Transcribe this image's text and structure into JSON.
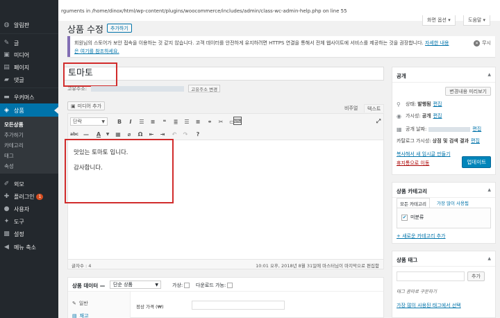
{
  "sidebar": {
    "items": [
      {
        "label": "알림판",
        "icon": "dashboard-icon",
        "glyph": "◍"
      },
      {
        "label": "글",
        "icon": "pin-icon",
        "glyph": "✎"
      },
      {
        "label": "미디어",
        "icon": "media-icon",
        "glyph": "▣"
      },
      {
        "label": "페이지",
        "icon": "page-icon",
        "glyph": "▤"
      },
      {
        "label": "댓글",
        "icon": "comment-icon",
        "glyph": "▰"
      },
      {
        "label": "우커머스",
        "icon": "woocommerce-icon",
        "glyph": "▬"
      },
      {
        "label": "상품",
        "icon": "product-icon",
        "glyph": "◈"
      },
      {
        "label": "외모",
        "icon": "appearance-icon",
        "glyph": "✐"
      },
      {
        "label": "플러그인",
        "icon": "plugin-icon",
        "glyph": "✚",
        "badge": "1"
      },
      {
        "label": "사용자",
        "icon": "user-icon",
        "glyph": "●"
      },
      {
        "label": "도구",
        "icon": "tool-icon",
        "glyph": "✦"
      },
      {
        "label": "설정",
        "icon": "settings-icon",
        "glyph": "▩"
      },
      {
        "label": "메뉴 축소",
        "icon": "collapse-icon",
        "glyph": "◀"
      }
    ],
    "submenu": [
      "모든상품",
      "추가하기",
      "카테고리",
      "태그",
      "속성"
    ]
  },
  "top": {
    "error_text": "rguments in /home/dinox/html/wp-content/plugins/woocommerce/includes/admin/class-wc-admin-help.php on line 55",
    "screen_options": "화면 옵션 ▾",
    "help": "도움말 ▾"
  },
  "header": {
    "title": "상품 수정",
    "add_new": "추가하기"
  },
  "notice": {
    "text": "회원님의 스토어가 보안 접속을 이용하는 것 같지 않습니다. 고객 데이터를 안전하게 유지하려면 HTTPS 연결을 통해서 전체 웹사이트에 서비스를 제공하는 것을 권장합니다.",
    "link": "자세한 내용은 여기를 참조하세요.",
    "dismiss": "무시"
  },
  "post": {
    "title": "토마토",
    "permalink_label": "고유주소:",
    "permalink_button": "고유주소 변경"
  },
  "editor": {
    "add_media": "미디어 추가",
    "tab_visual": "비주얼",
    "tab_text": "텍스트",
    "format": "단락",
    "content": [
      "맛있는 토마토 입니다.",
      "감사합니다."
    ],
    "word_count": "글자수 : 4",
    "last_edited": "10:01 오후, 2018년 8월 31일에 마스터님이 마지막으로 편집함"
  },
  "product_data": {
    "title": "상품 데이터 —",
    "type": "단순 상품",
    "virtual": "가상:",
    "downloadable": "다운로드 가능:",
    "tab_general": "일반",
    "tab_inventory": "재고",
    "regular_price_label": "정상 가격 (₩)"
  },
  "publish": {
    "title": "공개",
    "preview": "변경내용 미리보기",
    "status_label": "상태:",
    "status_value": "발행됨",
    "visibility_label": "가시성:",
    "visibility_value": "공개",
    "published_label": "공개 날짜:",
    "catalog_label": "카탈로그 가시성:",
    "catalog_value": "상점 및 검색 결과",
    "edit": "편집",
    "copy": "복사해서 새 임시글 만들기",
    "trash": "휴지통으로 이동",
    "update": "업데이트"
  },
  "categories": {
    "title": "상품 카테고리",
    "tab_all": "모든 카테고리",
    "tab_popular": "가장 많이 사용됨",
    "items": [
      "미분류"
    ],
    "add": "+ 새로운 카테고리 추가"
  },
  "tags": {
    "title": "상품 태그",
    "add": "추가",
    "hint": "태그 콤마로 구분하기",
    "popular": "가장 많이 사용된 태그에서 선택"
  },
  "colors": {
    "sidebar_bg": "#23282d",
    "active_blue": "#0073aa",
    "notice_purple": "#826eb4",
    "highlight_red": "#d12b2b",
    "update_blue": "#0085ba"
  }
}
